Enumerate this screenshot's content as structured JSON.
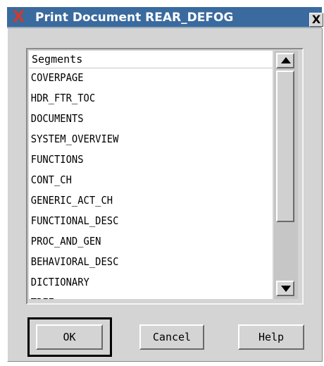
{
  "window": {
    "title": "Print Document REAR_DEFOG",
    "close_label": "X",
    "app_icon": "X"
  },
  "list": {
    "header": "Segments",
    "items": [
      "COVERPAGE",
      "HDR_FTR_TOC",
      "DOCUMENTS",
      "SYSTEM_OVERVIEW",
      "FUNCTIONS",
      "CONT_CH",
      "GENERIC_ACT_CH",
      "FUNCTIONAL_DESC",
      "PROC_AND_GEN",
      "BEHAVIORAL_DESC",
      "DICTIONARY",
      "TREE"
    ]
  },
  "buttons": {
    "ok": "OK",
    "cancel": "Cancel",
    "help": "Help"
  },
  "icons": {
    "scroll_up": "up-arrow-icon",
    "scroll_down": "down-arrow-icon"
  },
  "colors": {
    "titlebar": "#3a6a9e",
    "dialog_bg": "#d4d4d4",
    "app_icon": "#d03a2a"
  }
}
